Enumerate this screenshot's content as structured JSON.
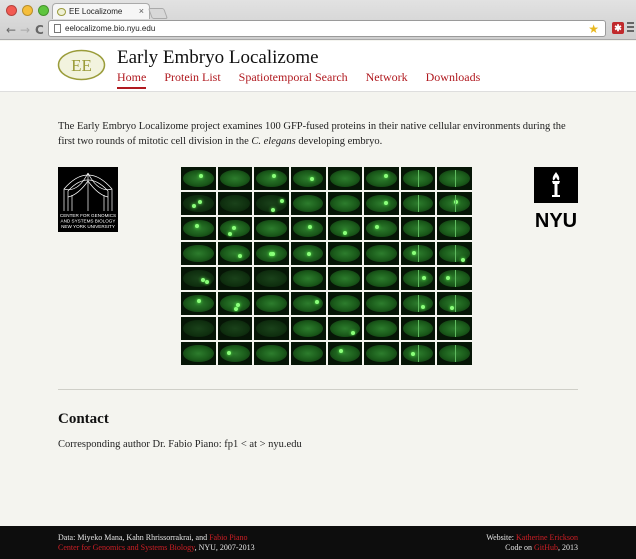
{
  "browser": {
    "tab_title": "EE Localizome",
    "tab_close": "×",
    "url": "eelocalizome.bio.nyu.edu",
    "back": "←",
    "forward": "→",
    "reload": "C",
    "star": "★",
    "extension": "✱"
  },
  "header": {
    "logo_text": "EE",
    "site_title": "Early Embryo Localizome",
    "nav": [
      "Home",
      "Protein List",
      "Spatiotemporal Search",
      "Network",
      "Downloads"
    ],
    "active_nav": "Home"
  },
  "intro": {
    "text_before": "The Early Embryo Localizome project examines 100 GFP-fused proteins in their native cellular environments during the first two rounds of mitotic cell division in the ",
    "species": "C. elegans",
    "text_after": " developing embryo."
  },
  "logos": {
    "cgsb": [
      "CENTER FOR GENOMICS",
      "AND SYSTEMS BIOLOGY",
      "NEW YORK UNIVERSITY"
    ],
    "nyu": "NYU"
  },
  "contact": {
    "heading": "Contact",
    "text": "Corresponding author Dr. Fabio Piano: fp1 < at > nyu.edu"
  },
  "footer": {
    "data_prefix": "Data: Miyeko Mana, Kahn Rhrissorrakrai, and ",
    "data_link": "Fabio Piano",
    "center_link": "Center for Genomics and Systems Biology",
    "center_suffix": ", NYU, 2007-2013",
    "website_prefix": "Website: ",
    "website_link": "Katherine Erickson",
    "code_prefix": "Code on ",
    "code_link": "GitHub",
    "code_suffix": ", 2013"
  },
  "colors": {
    "accent": "#b0191f",
    "page_bg": "#f4f4ef",
    "footer_bg": "#0d0d0d"
  }
}
